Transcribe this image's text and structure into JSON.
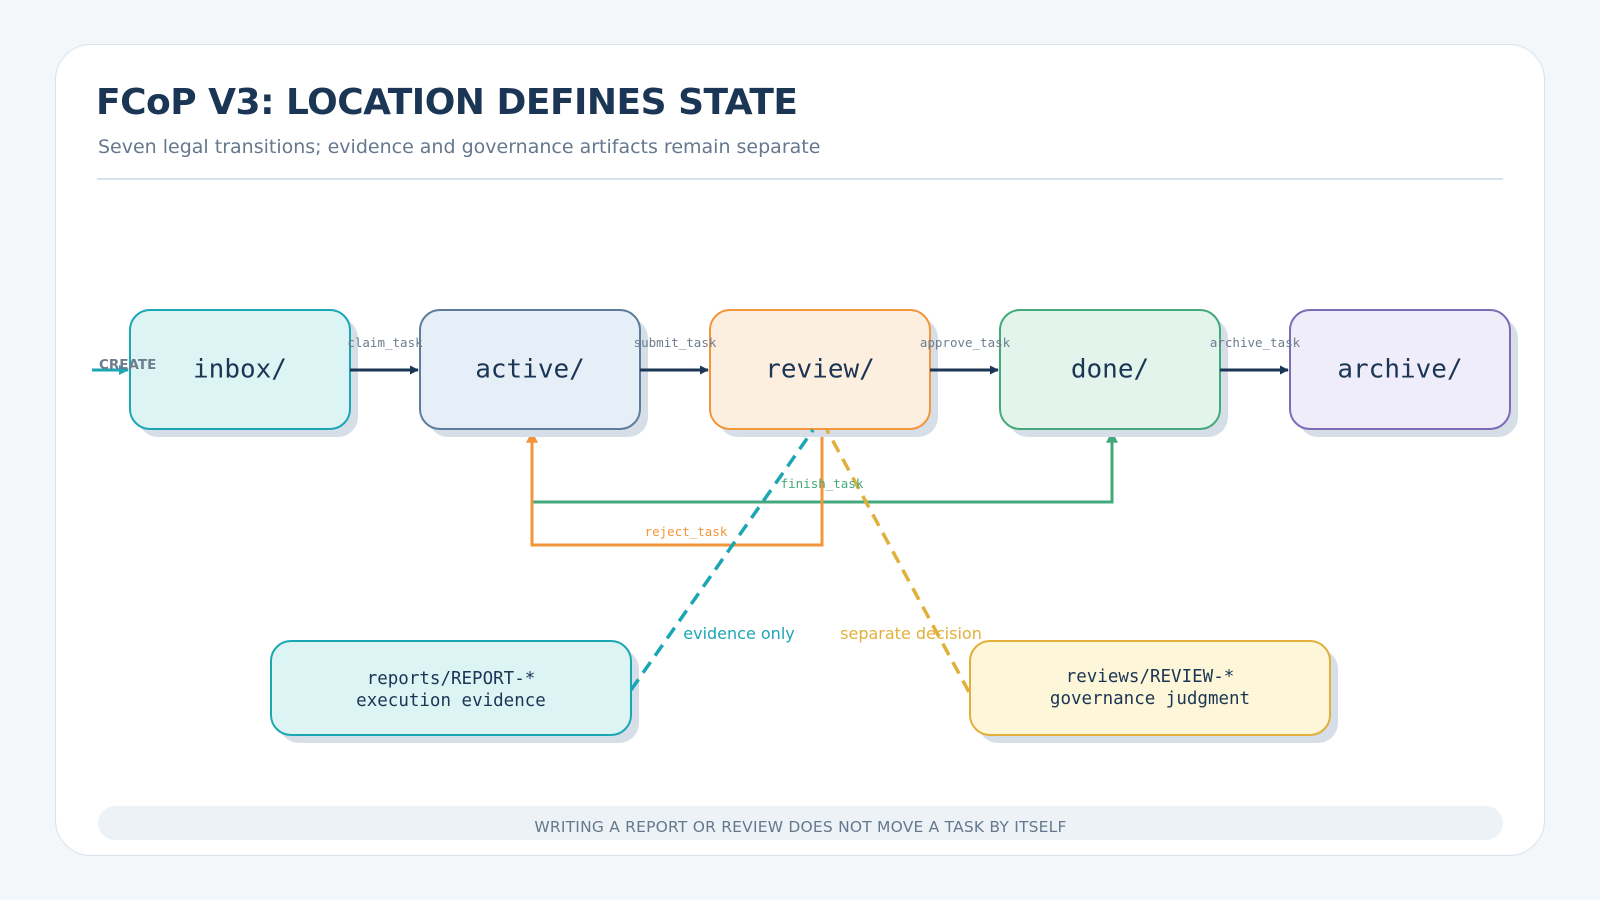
{
  "header": {
    "title": "FCoP V3: LOCATION DEFINES STATE",
    "subtitle": "Seven legal transitions; evidence and governance artifacts remain separate"
  },
  "states": [
    {
      "id": "inbox",
      "label": "inbox/",
      "fill": "#dcf4f4",
      "stroke": "#1ba6b4"
    },
    {
      "id": "active",
      "label": "active/",
      "fill": "#e6eef7",
      "stroke": "#5e7d9c"
    },
    {
      "id": "review",
      "label": "review/",
      "fill": "#fdefe0",
      "stroke": "#f2953b"
    },
    {
      "id": "done",
      "label": "done/",
      "fill": "#e2f4eb",
      "stroke": "#43a97a"
    },
    {
      "id": "archive",
      "label": "archive/",
      "fill": "#efedf9",
      "stroke": "#7d6bb8"
    }
  ],
  "create_label": "CREATE",
  "transitions": {
    "claim_task": "claim_task",
    "submit_task": "submit_task",
    "approve_task": "approve_task",
    "archive_task": "archive_task",
    "finish_task": "finish_task",
    "reject_task": "reject_task"
  },
  "artifacts": {
    "reports": {
      "line1": "reports/REPORT-*",
      "line2": "execution evidence",
      "callout": "evidence only",
      "fill": "#dcf4f4",
      "stroke": "#1ba6b4"
    },
    "reviews": {
      "line1": "reviews/REVIEW-*",
      "line2": "governance judgment",
      "callout": "separate decision",
      "fill": "#fef6d8",
      "stroke": "#e0b03a"
    }
  },
  "colors": {
    "main_flow": "#1b3555",
    "create": "#1ba6b4",
    "finish": "#43a97a",
    "reject": "#f2953b",
    "evidence": "#1ba6b4",
    "decision": "#e0b03a",
    "edge_label": "#6e7d8e"
  },
  "footer": {
    "note": "WRITING A REPORT OR REVIEW DOES NOT MOVE A TASK BY ITSELF"
  }
}
